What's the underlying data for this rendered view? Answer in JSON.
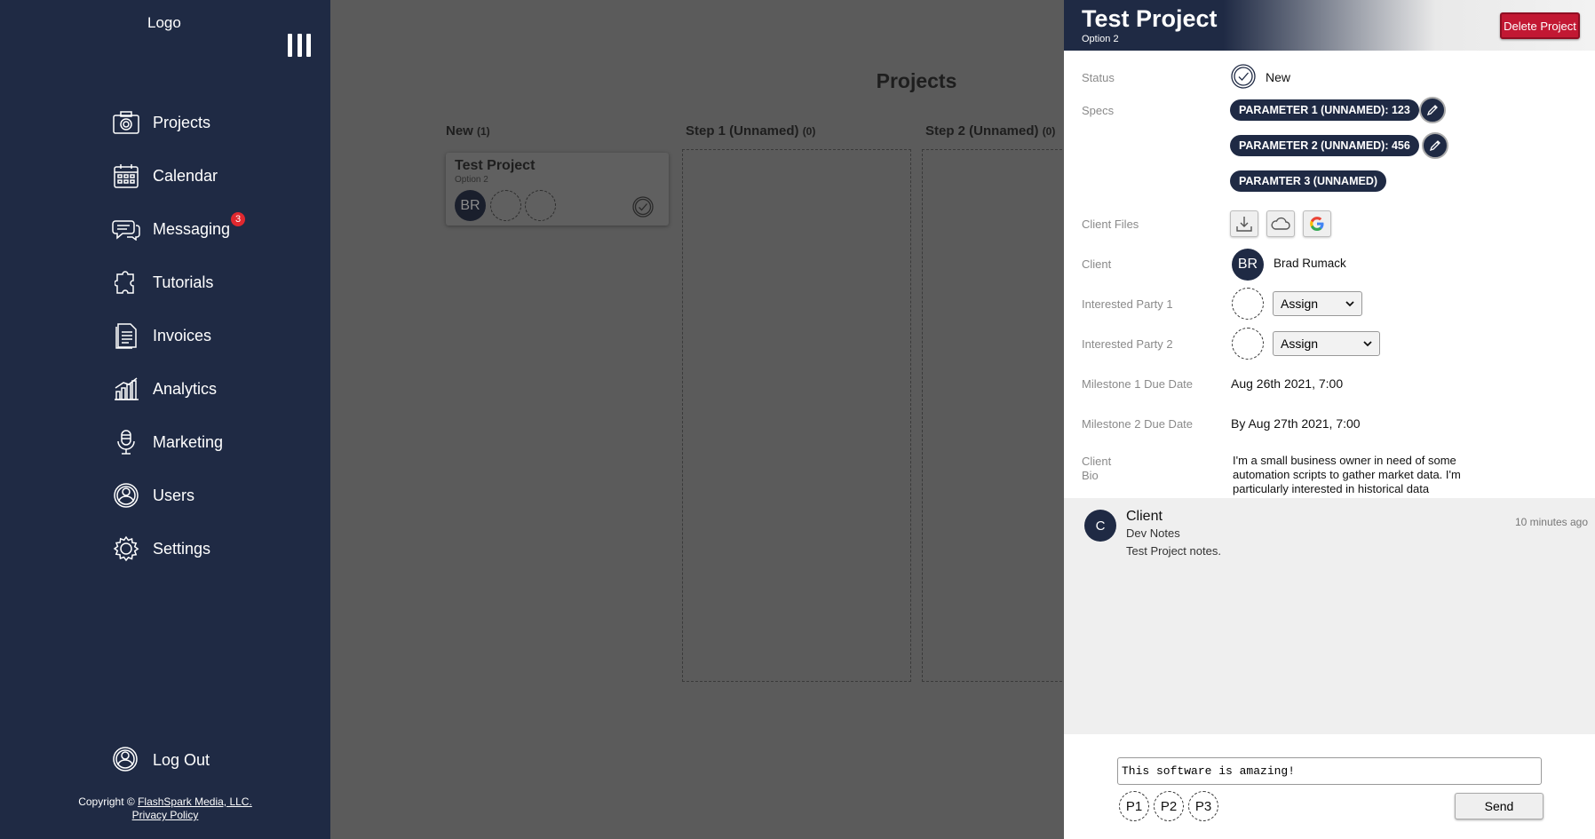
{
  "sidebar": {
    "logo": "Logo",
    "items": [
      {
        "label": "Projects",
        "icon": "camera-icon"
      },
      {
        "label": "Calendar",
        "icon": "calendar-icon"
      },
      {
        "label": "Messaging",
        "icon": "chat-icon",
        "badge": "3"
      },
      {
        "label": "Tutorials",
        "icon": "puzzle-icon"
      },
      {
        "label": "Invoices",
        "icon": "document-icon"
      },
      {
        "label": "Analytics",
        "icon": "bar-chart-icon"
      },
      {
        "label": "Marketing",
        "icon": "microphone-icon"
      },
      {
        "label": "Users",
        "icon": "user-icon"
      },
      {
        "label": "Settings",
        "icon": "gear-icon"
      }
    ],
    "logout": "Log Out",
    "copyright_prefix": "Copyright ©",
    "copyright_link": "FlashSpark Media, LLC.",
    "privacy": "Privacy Policy"
  },
  "board": {
    "title": "Projects",
    "columns": [
      {
        "name": "New",
        "count": "(1)"
      },
      {
        "name": "Step 1 (Unnamed)",
        "count": "(0)"
      },
      {
        "name": "Step 2 (Unnamed)",
        "count": "(0)"
      }
    ],
    "card": {
      "title": "Test Project",
      "subtitle": "Option 2",
      "avatar": "BR"
    }
  },
  "panel": {
    "title": "Test Project",
    "subtitle": "Option 2",
    "delete_label": "Delete Project",
    "labels": {
      "status": "Status",
      "specs": "Specs",
      "client_files": "Client Files",
      "client": "Client",
      "party1": "Interested Party 1",
      "party2": "Interested Party 2",
      "milestone1": "Milestone 1 Due Date",
      "milestone2": "Milestone 2 Due Date",
      "bio_line1": "Client",
      "bio_line2": "Bio"
    },
    "status": "New",
    "specs": [
      "PARAMETER 1 (UNNAMED): 123",
      "PARAMETER 2 (UNNAMED): 456",
      "PARAMTER 3 (UNNAMED)"
    ],
    "client_initials": "BR",
    "client_name": "Brad Rumack",
    "assign_label": "Assign",
    "milestone1": "Aug 26th 2021, 7:00",
    "milestone2": "By Aug 27th 2021, 7:00",
    "bio": "I'm a small business owner in need of some automation scripts to gather market data. I'm particularly interested in historical data"
  },
  "notes": {
    "avatar": "C",
    "author": "Client",
    "tag": "Dev Notes",
    "time": "10 minutes ago",
    "body": "Test Project notes."
  },
  "composer": {
    "value": "This software is amazing!",
    "tags": [
      "P1",
      "P2",
      "P3"
    ],
    "send": "Send"
  }
}
